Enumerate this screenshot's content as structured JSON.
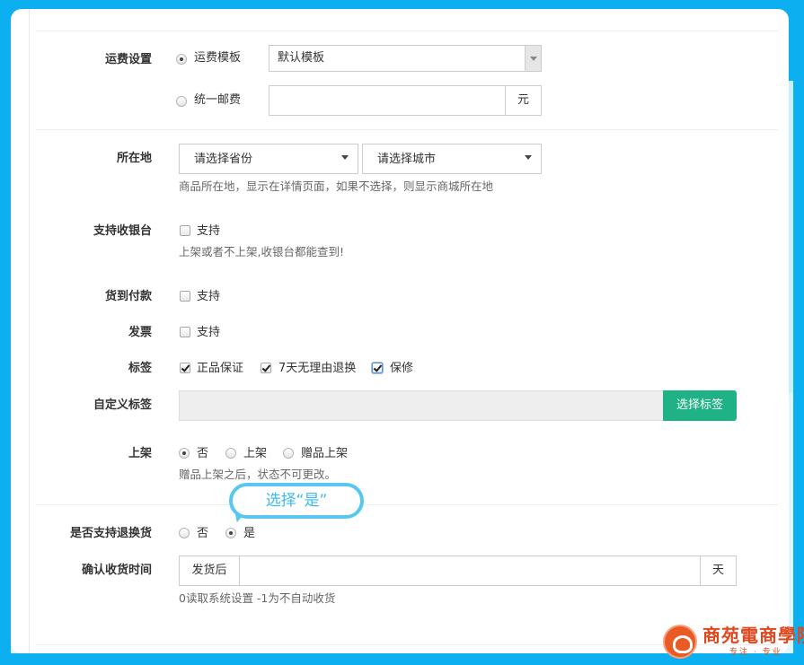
{
  "shipping": {
    "label": "运费设置",
    "option_template": "运费模板",
    "template_selected": "默认模板",
    "option_unified": "统一邮费",
    "unified_value": "",
    "unified_unit": "元"
  },
  "location": {
    "label": "所在地",
    "province_selected": "请选择省份",
    "city_selected": "请选择城市",
    "help": "商品所在地，显示在详情页面，如果不选择，则显示商城所在地"
  },
  "cashier": {
    "label": "支持收银台",
    "option": "支持",
    "help": "上架或者不上架,收银台都能查到!"
  },
  "cod": {
    "label": "货到付款",
    "option": "支持"
  },
  "invoice": {
    "label": "发票",
    "option": "支持"
  },
  "tags": {
    "label": "标签",
    "items": [
      "正品保证",
      "7天无理由退换",
      "保修"
    ]
  },
  "custom_tags": {
    "label": "自定义标签",
    "value": "",
    "button": "选择标签"
  },
  "listing": {
    "label": "上架",
    "options": [
      "否",
      "上架",
      "赠品上架"
    ],
    "help": "赠品上架之后，状态不可更改。"
  },
  "annotation": {
    "text": "选择“是”"
  },
  "returns": {
    "label": "是否支持退换货",
    "options": [
      "否",
      "是"
    ]
  },
  "confirm_receipt": {
    "label": "确认收货时间",
    "prefix": "发货后",
    "value": "",
    "suffix": "天",
    "help": "0读取系统设置 -1为不自动收货"
  },
  "logo": {
    "name": "商苑電商學院",
    "sub": "专注 · 专业"
  },
  "colors": {
    "frame": "#0cb0f0",
    "accent_green": "#1fb286",
    "annotation_blue": "#57c7ef",
    "logo_red": "#e0471d"
  }
}
